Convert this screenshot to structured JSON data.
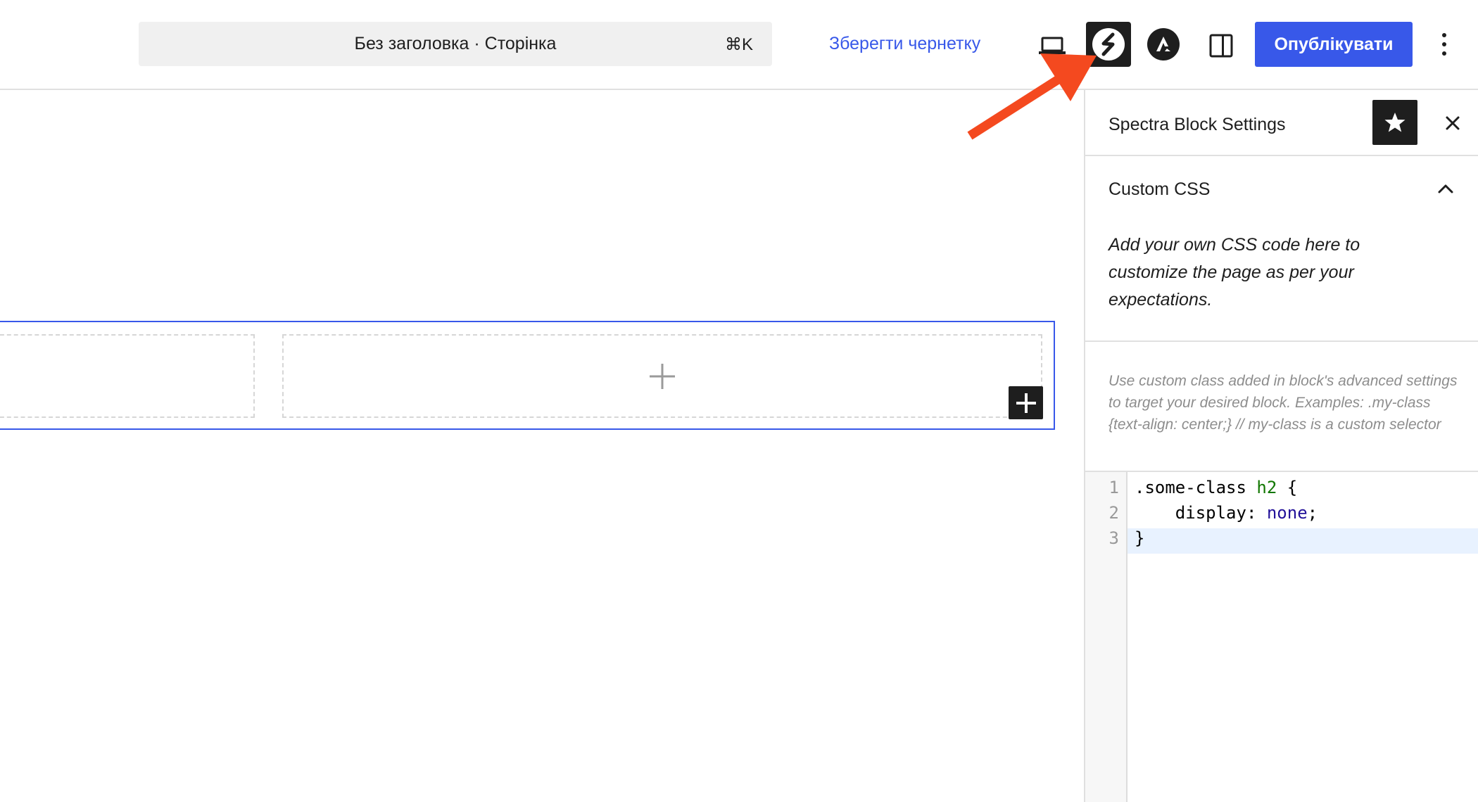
{
  "topbar": {
    "document_title": "Без заголовка · Сторінка",
    "shortcut": "⌘K",
    "save_draft_label": "Зберегти чернетку",
    "publish_label": "Опублікувати",
    "icons": [
      "laptop-icon",
      "spectra-logo-icon",
      "astra-logo-icon",
      "sidebar-toggle-icon",
      "more-vertical-icon"
    ]
  },
  "canvas": {
    "add_block_icon": "plus-icon"
  },
  "sidebar": {
    "title": "Spectra Block Settings",
    "panel": {
      "title": "Custom CSS",
      "description": "Add your own CSS code here to customize the page as per your expectations.",
      "help": "Use custom class added in block's advanced settings to target your desired block. Examples: .my-class {text-align: center;} // my-class is a custom selector"
    },
    "code": {
      "line_numbers": [
        "1",
        "2",
        "3"
      ],
      "line1": {
        "selector": ".some-class ",
        "tag": "h2",
        "brace": " {"
      },
      "line2": {
        "indent": "    ",
        "property": "display: ",
        "value": "none",
        "end": ";"
      },
      "line3": "}"
    }
  },
  "colors": {
    "accent": "#3858e9",
    "arrow": "#f4491f",
    "dark": "#1e1e1e"
  }
}
